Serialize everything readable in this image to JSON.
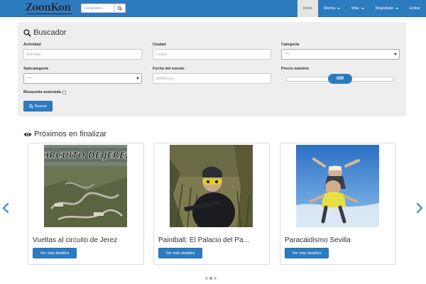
{
  "navbar": {
    "logo_text": "ZoonKon",
    "search": {
      "placeholder": "Localizador..."
    },
    "menu": [
      {
        "label": "Inicio",
        "active": true,
        "dropdown": false
      },
      {
        "label": "Idioma",
        "active": false,
        "dropdown": true
      },
      {
        "label": "Más",
        "active": false,
        "dropdown": true
      },
      {
        "label": "Regístrate",
        "active": false,
        "dropdown": true
      },
      {
        "label": "Entrar",
        "active": false,
        "dropdown": false
      }
    ],
    "bar_color": "#2d7bbf"
  },
  "search_panel": {
    "title": "Buscador",
    "activity": {
      "label": "Actividad",
      "placeholder": "Actividad"
    },
    "city": {
      "label": "Ciudad",
      "placeholder": "Ciudad"
    },
    "category": {
      "label": "Categoría",
      "selected": "----"
    },
    "subcategory": {
      "label": "Subcategoría",
      "selected": "----"
    },
    "event_date": {
      "label": "Fecha del evento",
      "placeholder": "dd/MM/yyyy"
    },
    "max_price": {
      "label": "Precio máximo",
      "value": "500",
      "fraction": 0.5
    },
    "advanced": {
      "label": "Búsqueda avanzada",
      "checked": false
    },
    "submit_label": "Buscar"
  },
  "section": {
    "title": "Próximos en finalizar"
  },
  "carousel": {
    "cards": [
      {
        "title": "Vueltas al circuito de Jerez",
        "image_caption": "CIRCUITO DE JEREZ",
        "button": "Ver más detalles"
      },
      {
        "title": "Paintball: El Palacio del Pa...",
        "button": "Ver más detalles"
      },
      {
        "title": "Paracaidismo Sevilla",
        "button": "Ver más detalles"
      }
    ],
    "indicator_count": 3,
    "active_indicator": 1
  }
}
